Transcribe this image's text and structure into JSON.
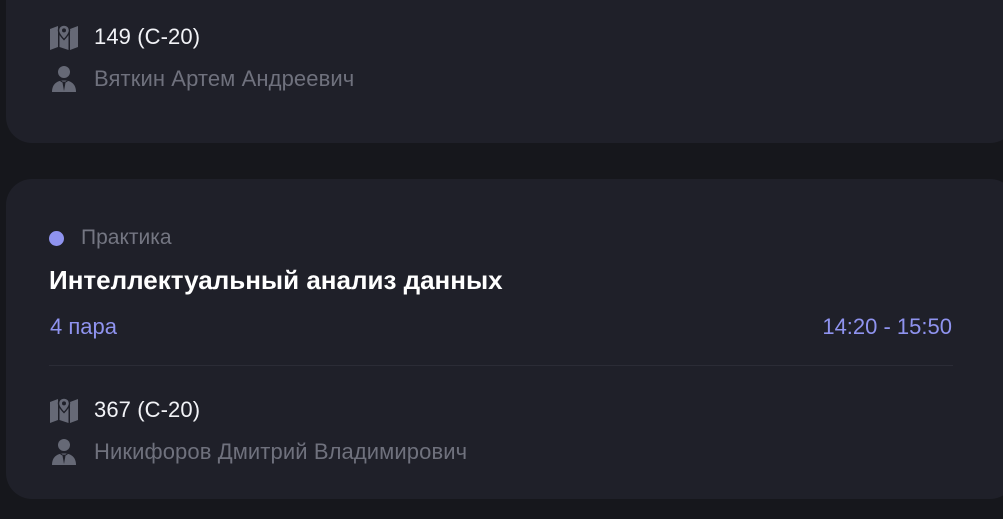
{
  "cards": [
    {
      "room": "149 (С-20)",
      "teacher": "Вяткин Артем Андреевич"
    },
    {
      "type": "Практика",
      "subject": "Интеллектуальный анализ данных",
      "pair": "4 пара",
      "time": "14:20 - 15:50",
      "room": "367 (С-20)",
      "teacher": "Никифоров Дмитрий Владимирович"
    }
  ],
  "colors": {
    "background": "#16171c",
    "card": "#1f2029",
    "accent": "#8f93ef",
    "primary_text": "#f2f3f7",
    "secondary_text": "#6f717d"
  },
  "icons": {
    "room": "map-icon",
    "teacher": "person-icon"
  }
}
